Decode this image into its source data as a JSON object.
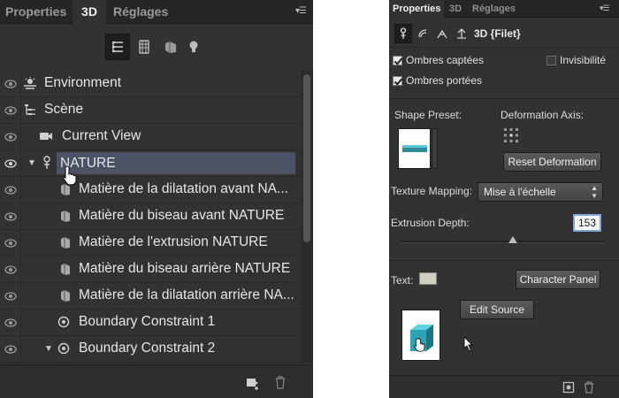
{
  "left_panel": {
    "tabs": [
      "Properties",
      "3D",
      "Réglages"
    ],
    "active_tab": "3D",
    "filters": [
      "whole-scene-filter-icon",
      "meshes-filter-icon",
      "materials-filter-icon",
      "lights-filter-icon"
    ],
    "tree": [
      {
        "label": "Environment",
        "icon": "environment-icon",
        "visible": true,
        "expanded": false,
        "selected": false
      },
      {
        "label": "Scène",
        "icon": "scene-icon",
        "visible": true,
        "expanded": false,
        "selected": false
      },
      {
        "label": "Current View",
        "icon": "camera-icon",
        "visible": true,
        "expanded": false,
        "selected": false
      },
      {
        "label": "NATURE",
        "icon": "mesh-icon",
        "visible": true,
        "expanded": true,
        "selected": true
      },
      {
        "label": "Matière de la dilatation avant NA...",
        "icon": "material-icon",
        "visible": true,
        "expanded": false,
        "selected": false
      },
      {
        "label": "Matière du biseau avant NATURE",
        "icon": "material-icon",
        "visible": true,
        "expanded": false,
        "selected": false
      },
      {
        "label": "Matière de l'extrusion NATURE",
        "icon": "material-icon",
        "visible": true,
        "expanded": false,
        "selected": false
      },
      {
        "label": "Matière du biseau arrière NATURE",
        "icon": "material-icon",
        "visible": true,
        "expanded": false,
        "selected": false
      },
      {
        "label": "Matière de la dilatation arrière NA...",
        "icon": "material-icon",
        "visible": true,
        "expanded": false,
        "selected": false
      },
      {
        "label": "Boundary Constraint 1",
        "icon": "constraint-icon",
        "visible": true,
        "expanded": false,
        "selected": false
      },
      {
        "label": "Boundary Constraint 2",
        "icon": "constraint-icon",
        "visible": true,
        "expanded": true,
        "selected": false
      }
    ]
  },
  "right_panel": {
    "tabs": [
      "Properties",
      "3D",
      "Réglages"
    ],
    "active_tab": "Properties",
    "mode_title": "3D {Filet}",
    "checkboxes": {
      "ombres_captees": {
        "label": "Ombres captées",
        "checked": true
      },
      "invisibilite": {
        "label": "Invisibilité",
        "checked": false
      },
      "ombres_portees": {
        "label": "Ombres portées",
        "checked": true
      }
    },
    "shape_preset_label": "Shape Preset:",
    "deformation_axis_label": "Deformation Axis:",
    "reset_deformation": "Reset Deformation",
    "texture_mapping_label": "Texture Mapping:",
    "texture_mapping_value": "Mise à l'échelle",
    "extrusion_depth_label": "Extrusion Depth:",
    "extrusion_depth_value": "153",
    "extrusion_depth_slider": 0.55,
    "text_label": "Text:",
    "text_color": "#cfcfc0",
    "character_panel": "Character Panel",
    "edit_source": "Edit Source"
  }
}
